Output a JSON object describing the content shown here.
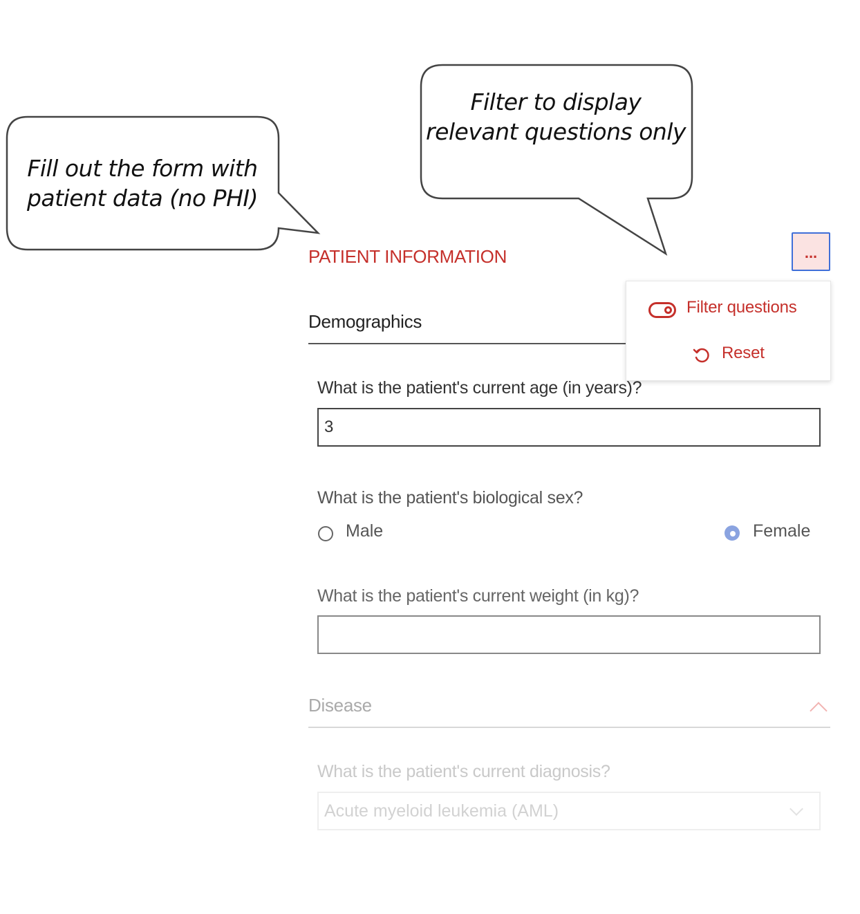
{
  "callouts": {
    "left": "Fill out the form with patient data (no PHI)",
    "right": "Filter to display relevant questions only"
  },
  "section": {
    "title": "PATIENT INFORMATION",
    "more_label": "..."
  },
  "menu": {
    "filter_label": "Filter questions",
    "reset_label": "Reset",
    "filter_icon": "toggle-icon",
    "reset_icon": "reset-icon"
  },
  "demographics": {
    "title": "Demographics",
    "age_question": "What is the patient's current age (in years)?",
    "age_value": "3",
    "sex_question": "What is the patient's biological sex?",
    "sex_options": [
      "Male",
      "Female"
    ],
    "sex_selected": "Female",
    "weight_question": "What is the patient's current weight (in kg)?",
    "weight_value": ""
  },
  "disease": {
    "title": "Disease",
    "diagnosis_question": "What is the patient's current diagnosis?",
    "diagnosis_value": "Acute myeloid leukemia (AML)"
  },
  "colors": {
    "accent": "#c5302b",
    "focus_border": "#3f6fd8",
    "radio_selected": "#8aa3e0"
  }
}
